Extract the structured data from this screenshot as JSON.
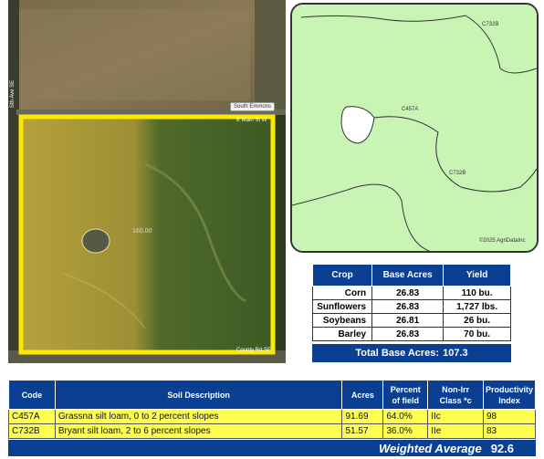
{
  "aerial": {
    "road_west": "Sth Ave SE",
    "road_north_tag": "South Emmons",
    "road_mid": "E Main St W",
    "road_south": "County Rd SE",
    "field_acres": "160.00"
  },
  "soil_map": {
    "labels": [
      "C732B",
      "C457A",
      "C732B"
    ],
    "copyright": "©2025 AgriDataInc"
  },
  "crop_table": {
    "headers": {
      "crop": "Crop",
      "base_acres": "Base Acres",
      "yield": "Yield"
    },
    "rows": [
      {
        "crop": "Corn",
        "base_acres": "26.83",
        "yield": "110 bu."
      },
      {
        "crop": "Sunflowers",
        "base_acres": "26.83",
        "yield": "1,727 lbs."
      },
      {
        "crop": "Soybeans",
        "base_acres": "26.81",
        "yield": "26 bu."
      },
      {
        "crop": "Barley",
        "base_acres": "26.83",
        "yield": "70 bu."
      }
    ],
    "total_label": "Total Base Acres:",
    "total_value": "107.3"
  },
  "soil_table": {
    "headers": {
      "code": "Code",
      "description": "Soil Description",
      "acres": "Acres",
      "percent_line1": "Percent",
      "percent_line2": "of field",
      "class_line1": "Non-Irr",
      "class_line2": "Class *c",
      "prod_line1": "Productivity",
      "prod_line2": "Index"
    },
    "rows": [
      {
        "code": "C457A",
        "description": "Grassna silt loam, 0 to 2 percent slopes",
        "acres": "91.69",
        "percent": "64.0%",
        "class": "IIc",
        "index": "98"
      },
      {
        "code": "C732B",
        "description": "Bryant silt loam, 2 to 6 percent slopes",
        "acres": "51.57",
        "percent": "36.0%",
        "class": "IIe",
        "index": "83"
      }
    ],
    "weighted_label": "Weighted Average",
    "weighted_value": "92.6"
  },
  "colors": {
    "header_blue": "#0a3f91",
    "row_yellow": "#ffff4d",
    "field_outline": "#ffe800",
    "soil_green": "#c8f5b4"
  }
}
